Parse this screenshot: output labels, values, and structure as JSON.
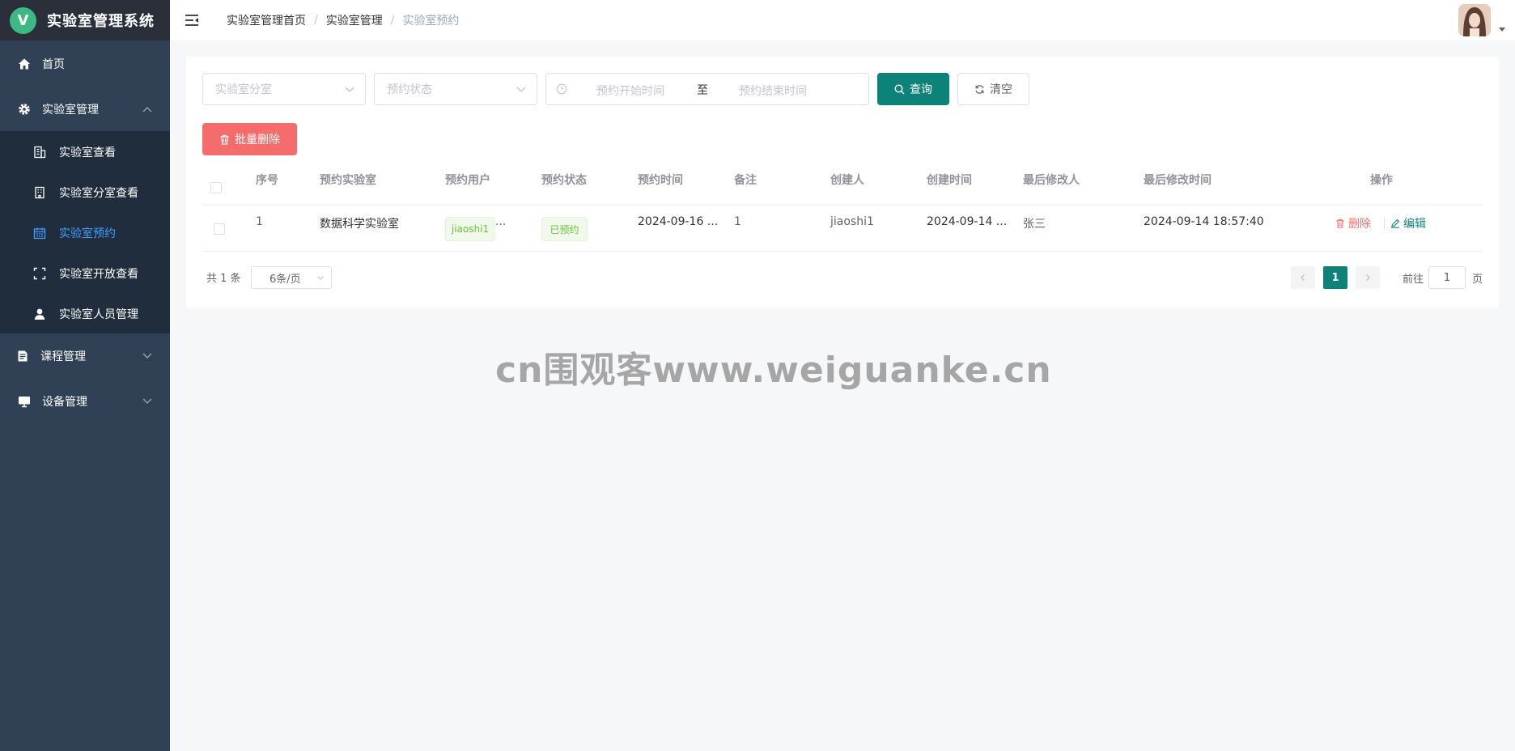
{
  "app": {
    "logo_letter": "V",
    "title": "实验室管理系统"
  },
  "sidebar": {
    "items": [
      {
        "label": "首页",
        "icon": "home-icon"
      },
      {
        "label": "实验室管理",
        "icon": "gear-icon",
        "expanded": true
      },
      {
        "label": "课程管理",
        "icon": "document-icon"
      },
      {
        "label": "设备管理",
        "icon": "monitor-icon"
      }
    ],
    "subitems": [
      {
        "label": "实验室查看",
        "icon": "building-icon"
      },
      {
        "label": "实验室分室查看",
        "icon": "office-building-icon"
      },
      {
        "label": "实验室预约",
        "icon": "calendar-icon",
        "active": true
      },
      {
        "label": "实验室开放查看",
        "icon": "fullscreen-icon"
      },
      {
        "label": "实验室人员管理",
        "icon": "user-icon"
      }
    ]
  },
  "header": {
    "breadcrumb": [
      "实验室管理首页",
      "实验室管理",
      "实验室预约"
    ],
    "separator": "/"
  },
  "filters": {
    "room_placeholder": "实验室分室",
    "status_placeholder": "预约状态",
    "start_placeholder": "预约开始时间",
    "range_sep": "至",
    "end_placeholder": "预约结束时间",
    "query_label": "查询",
    "clear_label": "清空"
  },
  "toolbar": {
    "batch_delete_label": "批量删除"
  },
  "table": {
    "columns": [
      "序号",
      "预约实验室",
      "预约用户",
      "预约状态",
      "预约时间",
      "备注",
      "创建人",
      "创建时间",
      "最后修改人",
      "最后修改时间",
      "操作"
    ],
    "rows": [
      {
        "index": "1",
        "lab": "数据科学实验室",
        "user": "jiaoshi1",
        "user_more": "...",
        "status": "已预约",
        "time": "2024-09-16 ...",
        "remark": "1",
        "creator": "jiaoshi1",
        "created": "2024-09-14 ...",
        "modifier": "张三",
        "modified": "2024-09-14 18:57:40",
        "delete_label": "删除",
        "edit_label": "编辑"
      }
    ]
  },
  "pagination": {
    "total_text": "共 1 条",
    "page_size": "6条/页",
    "current_page": "1",
    "goto_label": "前往",
    "goto_value": "1",
    "page_suffix": "页"
  },
  "watermark": "cn围观客www.weiguanke.cn",
  "colors": {
    "sidebar": "#304156",
    "submenu": "#1f2d3d",
    "primary": "#0d8278",
    "danger": "#f56c6c",
    "active_menu": "#409eff"
  }
}
